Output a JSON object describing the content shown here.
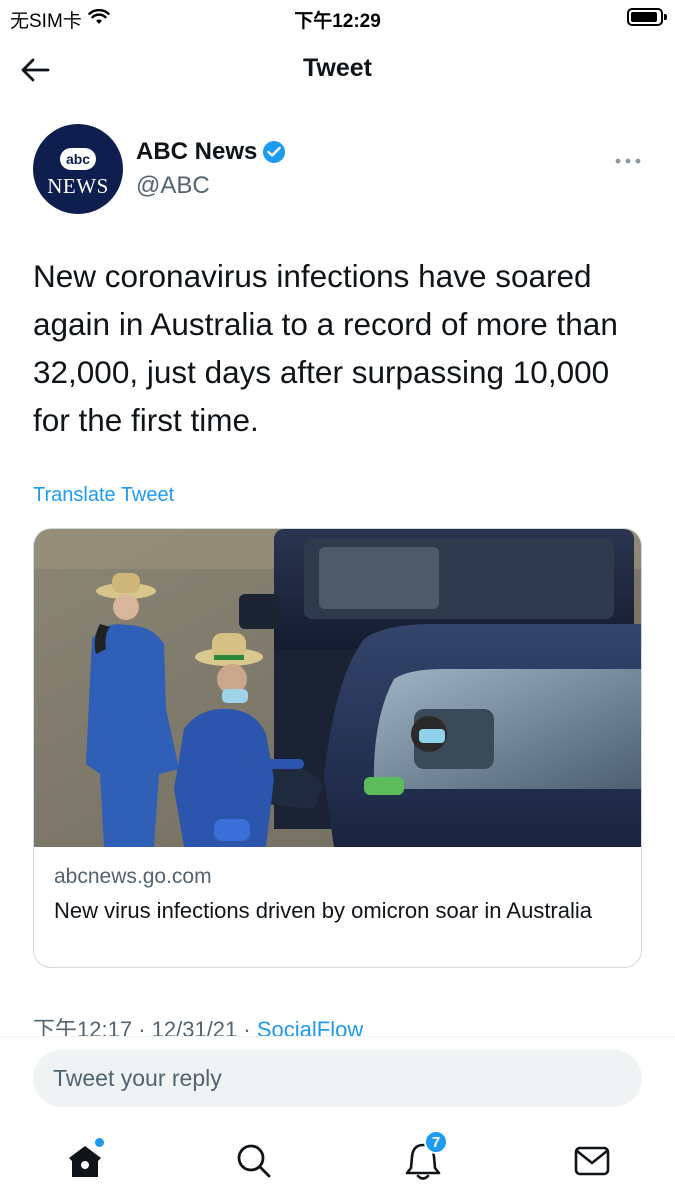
{
  "status_bar": {
    "carrier": "无SIM卡",
    "time": "下午12:29"
  },
  "header": {
    "title": "Tweet",
    "back_icon": "arrow-left-icon"
  },
  "author": {
    "name": "ABC News",
    "handle": "@ABC",
    "verified": true,
    "avatar_logo_text": [
      "abc",
      "NEWS"
    ],
    "more_icon": "more-horizontal-icon"
  },
  "tweet": {
    "text": "New coronavirus infections have soared again in Australia to a record of more than 32,000, just days after surpassing 10,000 for the first time.",
    "translate_label": "Translate Tweet"
  },
  "card": {
    "domain": "abcnews.go.com",
    "title": "New virus infections driven by omicron soar in Australia"
  },
  "meta": {
    "time": "下午12:17",
    "separator": "·",
    "date": "12/31/21",
    "source": "SocialFlow"
  },
  "reply": {
    "placeholder": "Tweet your reply"
  },
  "tabbar": {
    "items": [
      {
        "name": "home",
        "icon": "home-icon",
        "has_dot": true
      },
      {
        "name": "search",
        "icon": "search-icon"
      },
      {
        "name": "notifications",
        "icon": "bell-icon",
        "badge": "7"
      },
      {
        "name": "messages",
        "icon": "mail-icon"
      }
    ]
  },
  "colors": {
    "accent": "#1d9bf0",
    "text_primary": "#0f1419",
    "text_secondary": "#536471",
    "avatar_bg": "#0e1f4f"
  }
}
